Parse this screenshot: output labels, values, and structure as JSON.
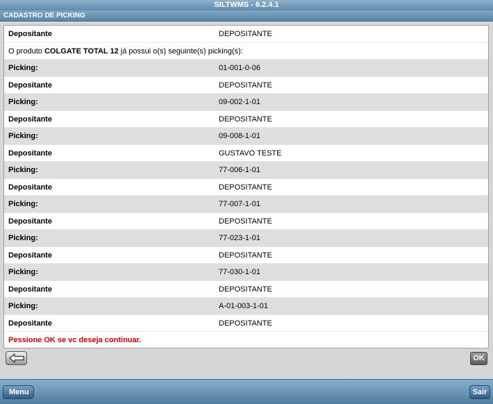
{
  "app": {
    "title": "SILTWMS - 6.2.4.1"
  },
  "section": {
    "title": "CADASTRO DE PICKING"
  },
  "header_row": {
    "label": "Depositante",
    "value": "DEPOSITANTE"
  },
  "message": {
    "prefix": "O produto ",
    "product": "COLGATE TOTAL 12",
    "suffix": " já possui o(s) seguinte(s) picking(s):"
  },
  "entries": [
    {
      "picking_label": "Picking:",
      "picking": "01-001-0-06",
      "dep_label": "Depositante",
      "depositante": "DEPOSITANTE"
    },
    {
      "picking_label": "Picking:",
      "picking": "09-002-1-01",
      "dep_label": "Depositante",
      "depositante": "DEPOSITANTE"
    },
    {
      "picking_label": "Picking:",
      "picking": "09-008-1-01",
      "dep_label": "Depositante",
      "depositante": "GUSTAVO TESTE"
    },
    {
      "picking_label": "Picking:",
      "picking": "77-006-1-01",
      "dep_label": "Depositante",
      "depositante": "DEPOSITANTE"
    },
    {
      "picking_label": "Picking:",
      "picking": "77-007-1-01",
      "dep_label": "Depositante",
      "depositante": "DEPOSITANTE"
    },
    {
      "picking_label": "Picking:",
      "picking": "77-023-1-01",
      "dep_label": "Depositante",
      "depositante": "DEPOSITANTE"
    },
    {
      "picking_label": "Picking:",
      "picking": "77-030-1-01",
      "dep_label": "Depositante",
      "depositante": "DEPOSITANTE"
    },
    {
      "picking_label": "Picking:",
      "picking": "A-01-003-1-01",
      "dep_label": "Depositante",
      "depositante": "DEPOSITANTE"
    }
  ],
  "warning": "Pessione OK se vc deseja continuar.",
  "buttons": {
    "back_icon": "arrow-left-icon",
    "ok": "OK",
    "menu": "Menu",
    "sair": "Sair"
  },
  "colors": {
    "header_blue": "#5f8aab",
    "warning_red": "#d40000",
    "row_shade": "#dedede"
  }
}
